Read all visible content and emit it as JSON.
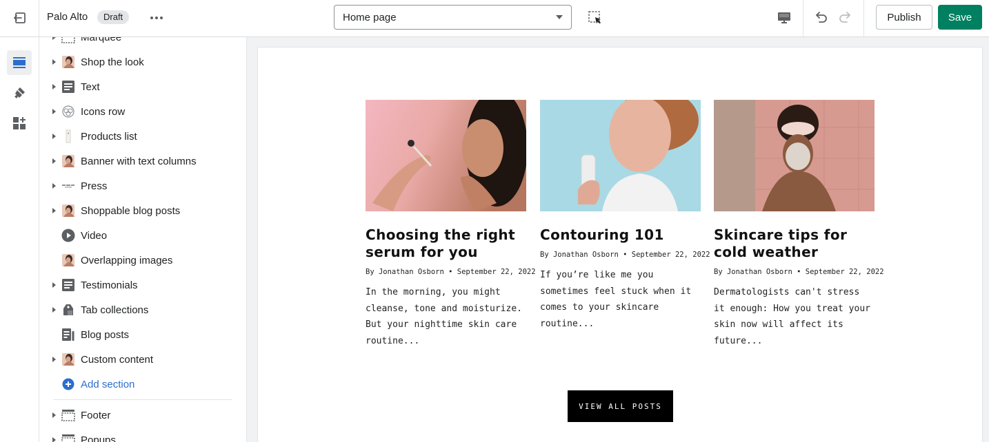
{
  "topbar": {
    "store_name": "Palo Alto",
    "status_badge": "Draft",
    "page_selector_value": "Home page",
    "publish_label": "Publish",
    "save_label": "Save",
    "save_color": "#008060"
  },
  "rail": {
    "items": [
      {
        "icon": "sections-icon",
        "active": true
      },
      {
        "icon": "theme-settings-brush-icon",
        "active": false
      },
      {
        "icon": "app-blocks-icon",
        "active": false
      }
    ]
  },
  "sidebar": {
    "sections": [
      {
        "label": "Marquee",
        "icon": "marquee-icon",
        "expandable": true
      },
      {
        "label": "Shop the look",
        "icon": "image-thumbnail-icon",
        "expandable": true
      },
      {
        "label": "Text",
        "icon": "text-block-icon",
        "expandable": true
      },
      {
        "label": "Icons row",
        "icon": "icons-row-icon",
        "expandable": true
      },
      {
        "label": "Products list",
        "icon": "products-list-icon",
        "expandable": true
      },
      {
        "label": "Banner with text columns",
        "icon": "image-thumbnail-icon",
        "expandable": true
      },
      {
        "label": "Press",
        "icon": "press-logo-icon",
        "expandable": true
      },
      {
        "label": "Shoppable blog posts",
        "icon": "image-thumbnail-icon",
        "expandable": true
      },
      {
        "label": "Video",
        "icon": "play-icon",
        "expandable": false
      },
      {
        "label": "Overlapping images",
        "icon": "image-thumbnail-icon",
        "expandable": false
      },
      {
        "label": "Testimonials",
        "icon": "text-block-icon",
        "expandable": true
      },
      {
        "label": "Tab collections",
        "icon": "tag-icon",
        "expandable": true
      },
      {
        "label": "Blog posts",
        "icon": "blog-icon",
        "expandable": false
      },
      {
        "label": "Custom content",
        "icon": "image-thumbnail-icon",
        "expandable": true
      }
    ],
    "add_section_label": "Add section",
    "footer_sections": [
      {
        "label": "Footer",
        "icon": "footer-icon",
        "expandable": true
      },
      {
        "label": "Popups",
        "icon": "popup-icon",
        "expandable": true
      }
    ]
  },
  "preview": {
    "posts": [
      {
        "title": "Choosing the right serum for you",
        "meta": "By Jonathan Osborn • September 22, 2022",
        "excerpt": "In the morning, you might cleanse, tone and moisturize. But your nighttime skin care routine..."
      },
      {
        "title": "Contouring 101",
        "meta": "By Jonathan Osborn • September 22, 2022",
        "excerpt": "If you’re like me you sometimes feel stuck when it comes to your skincare routine..."
      },
      {
        "title": "Skincare tips for cold weather",
        "meta": "By Jonathan Osborn • September 22, 2022",
        "excerpt": "Dermatologists can't stress it enough: How you treat your skin now will affect its future..."
      }
    ],
    "view_all_label": "VIEW ALL POSTS"
  }
}
